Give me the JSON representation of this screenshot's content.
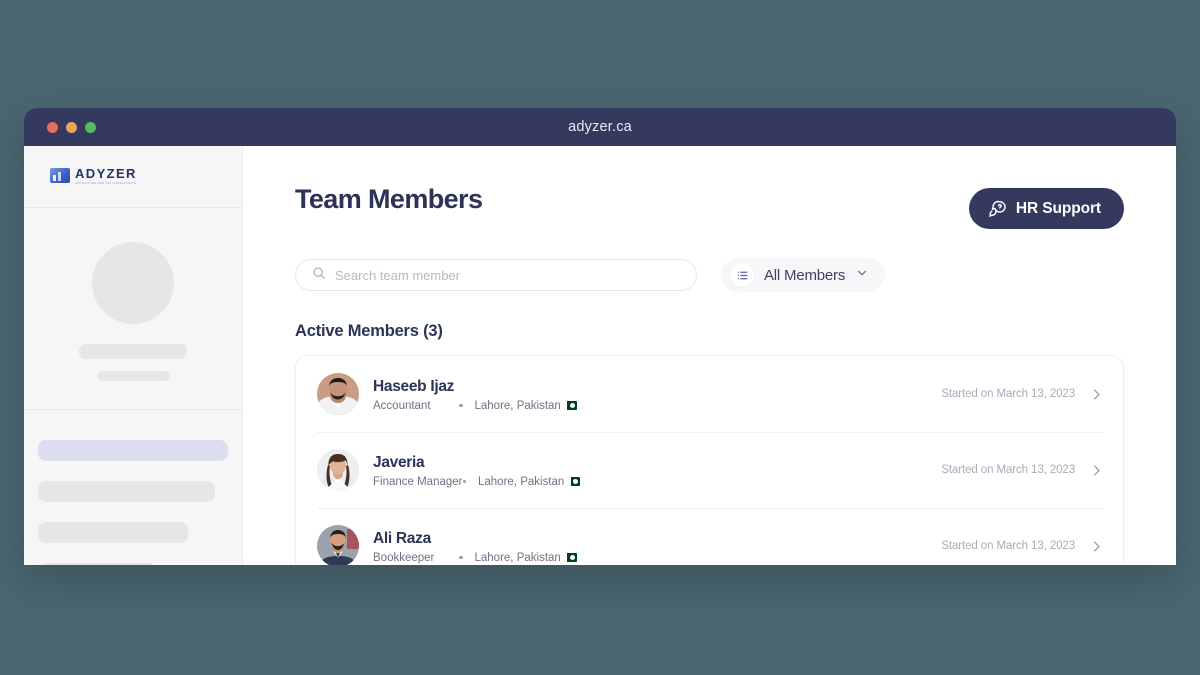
{
  "window": {
    "url": "adyzer.ca",
    "traffic_lights": [
      "close",
      "minimize",
      "maximize"
    ]
  },
  "sidebar": {
    "logo": {
      "word": "ADYZER",
      "tagline": "ACCOUNTING AND TAX CONSULTANTS",
      "icon": "adyzer-logo-icon"
    },
    "skeleton": {
      "avatar": "placeholder",
      "name_bar": "placeholder",
      "sub_bar": "placeholder",
      "nav_items": [
        "active",
        "item",
        "item",
        "item"
      ]
    }
  },
  "header": {
    "title": "Team Members",
    "hr_support_label": "HR Support",
    "hr_support_icon": "chat-question-icon"
  },
  "controls": {
    "search": {
      "placeholder": "Search team member",
      "value": "",
      "icon": "search-icon"
    },
    "filter": {
      "label": "All Members",
      "icon": "list-icon",
      "chevron": "chevron-down-icon"
    }
  },
  "section": {
    "title": "Active Members (3)",
    "members": [
      {
        "name": "Haseeb Ijaz",
        "role": "Accountant",
        "location": "Lahore, Pakistan",
        "flag": "pakistan-flag-icon",
        "started": "Started on March 13, 2023",
        "chevron": "chevron-right-icon"
      },
      {
        "name": "Javeria",
        "role": "Finance Manager",
        "location": "Lahore, Pakistan",
        "flag": "pakistan-flag-icon",
        "started": "Started on March 13, 2023",
        "chevron": "chevron-right-icon"
      },
      {
        "name": "Ali Raza",
        "role": "Bookkeeper",
        "location": "Lahore, Pakistan",
        "flag": "pakistan-flag-icon",
        "started": "Started on March 13, 2023",
        "chevron": "chevron-right-icon"
      }
    ]
  },
  "colors": {
    "page_background": "#4a6670",
    "titlebar": "#343a5e",
    "accent_dark": "#343a5e",
    "skeleton_gray": "#e6e6e8",
    "skeleton_active": "#dcdef0",
    "light_red": "#e2705c",
    "light_amber": "#e8a65c",
    "light_green": "#5cb85c"
  }
}
